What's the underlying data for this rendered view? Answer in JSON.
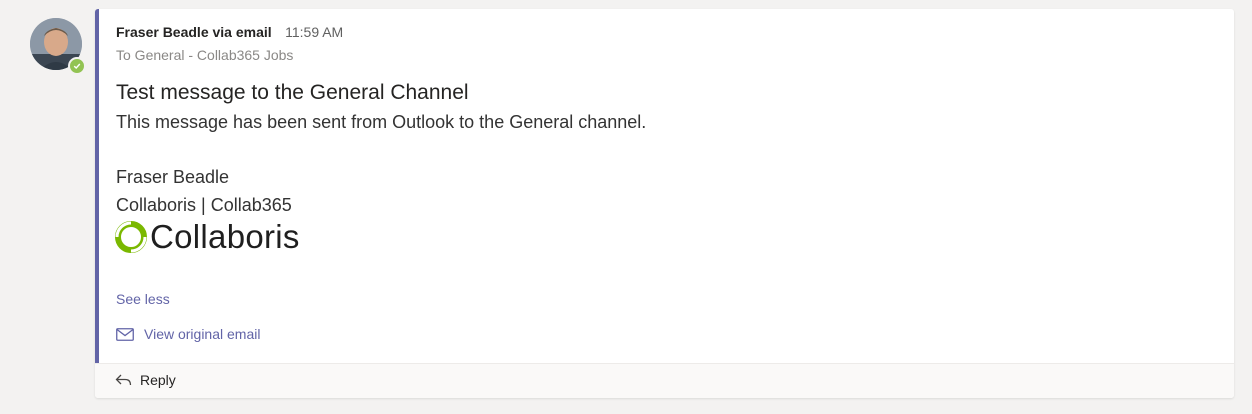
{
  "message": {
    "sender": "Fraser Beadle via email",
    "time": "11:59 AM",
    "recipient": "To General - Collab365 Jobs",
    "subject": "Test message to the General Channel",
    "body": "This message has been sent from Outlook to the General channel.",
    "signature_name": "Fraser Beadle",
    "signature_org": "Collaboris | Collab365",
    "logo_text": "Collaboris"
  },
  "actions": {
    "see_less": "See less",
    "view_original": "View original email",
    "reply": "Reply"
  },
  "icons": {
    "status": "available-check-icon",
    "mail": "mail-icon",
    "reply": "reply-arrow-icon",
    "logo": "collaboris-logo-icon"
  },
  "colors": {
    "accent": "#6264a7",
    "status_available": "#92c353",
    "logo_green": "#7ab800"
  }
}
